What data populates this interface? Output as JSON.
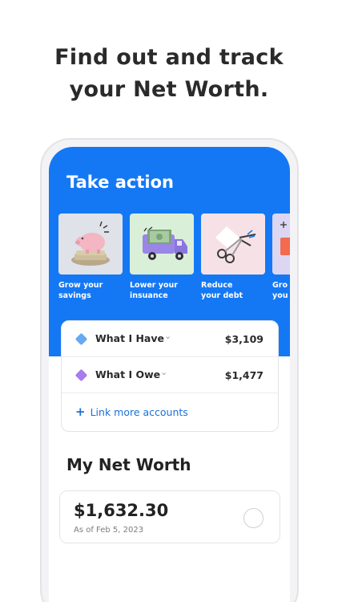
{
  "headline": {
    "line1": "Find out and track",
    "line2": "your Net Worth."
  },
  "take_action": {
    "title": "Take action",
    "cards": [
      {
        "label": "Grow your\nsavings",
        "bg": "#dfe2e8",
        "icon": "piggy-bank-icon"
      },
      {
        "label": "Lower your\ninsuance",
        "bg": "#d9efd8",
        "icon": "money-truck-icon"
      },
      {
        "label": "Reduce\nyour debt",
        "bg": "#f6e2e6",
        "icon": "scissors-card-icon"
      },
      {
        "label": "Gro\nyou",
        "bg": "#ddd6f3",
        "icon": "partial-card-icon"
      }
    ]
  },
  "accounts": {
    "rows": [
      {
        "label": "What I Have",
        "value": "$3,109",
        "color": "#6aa8f2"
      },
      {
        "label": "What I Owe",
        "value": "$1,477",
        "color": "#a77cec"
      }
    ],
    "link_more": "Link more accounts"
  },
  "net_worth": {
    "title": "My Net Worth",
    "amount": "$1,632.30",
    "as_of": "As of Feb 5, 2023"
  },
  "colors": {
    "brand_blue": "#1478f5",
    "link_blue": "#1a6fd8"
  }
}
